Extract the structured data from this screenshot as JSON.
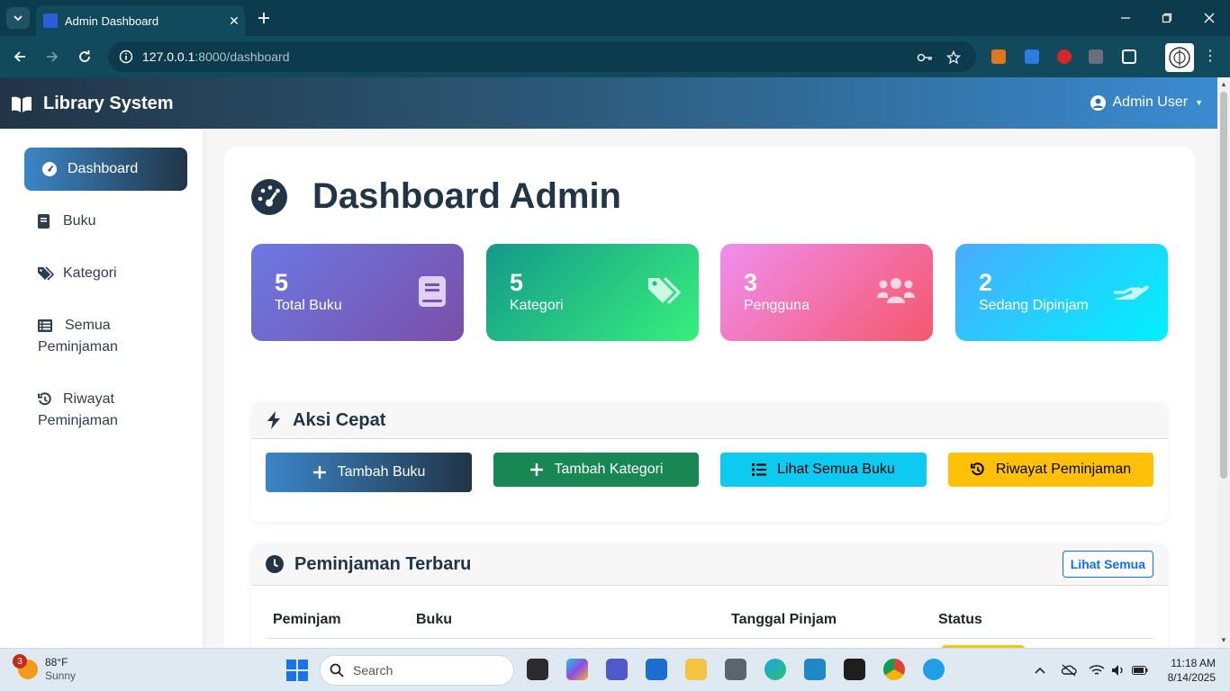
{
  "browser": {
    "tab_title": "Admin Dashboard",
    "url_host": "127.0.0.1",
    "url_rest": ":8000/dashboard"
  },
  "app": {
    "brand": "Library System",
    "user": "Admin User"
  },
  "sidebar": {
    "items": [
      {
        "label": "Dashboard",
        "icon": "gauge-icon",
        "active": true
      },
      {
        "label": "Buku",
        "icon": "book-icon"
      },
      {
        "label": "Kategori",
        "icon": "tags-icon"
      },
      {
        "label": "Semua",
        "label2": "Peminjaman",
        "icon": "list-icon"
      },
      {
        "label": "Riwayat",
        "label2": "Peminjaman",
        "icon": "history-icon"
      }
    ]
  },
  "page": {
    "title": "Dashboard Admin"
  },
  "stats": [
    {
      "value": "5",
      "label": "Total Buku",
      "icon": "book-icon",
      "colors": [
        "#6b79e3",
        "#7b4fa8"
      ]
    },
    {
      "value": "5",
      "label": "Kategori",
      "icon": "tags-icon",
      "colors": [
        "#14998a",
        "#38ef7d"
      ]
    },
    {
      "value": "3",
      "label": "Pengguna",
      "icon": "users-icon",
      "colors": [
        "#f08ef0",
        "#f5576c"
      ]
    },
    {
      "value": "2",
      "label": "Sedang Dipinjam",
      "icon": "hand-icon",
      "colors": [
        "#4aabff",
        "#00f2fe"
      ]
    }
  ],
  "quick_actions": {
    "title": "Aksi Cepat",
    "buttons": [
      {
        "label": "Tambah Buku",
        "icon": "plus-icon"
      },
      {
        "label": "Tambah Kategori",
        "icon": "plus-icon"
      },
      {
        "label": "Lihat Semua Buku",
        "icon": "list-icon"
      },
      {
        "label": "Riwayat Peminjaman",
        "icon": "history-icon"
      }
    ]
  },
  "recent": {
    "title": "Peminjaman Terbaru",
    "view_all": "Lihat Semua",
    "columns": [
      "Peminjam",
      "Buku",
      "Tanggal Pinjam",
      "Status"
    ]
  },
  "taskbar": {
    "weather_temp": "88°F",
    "weather_desc": "Sunny",
    "weather_badge": "3",
    "search_placeholder": "Search",
    "time": "11:18 AM",
    "date": "8/14/2025"
  }
}
